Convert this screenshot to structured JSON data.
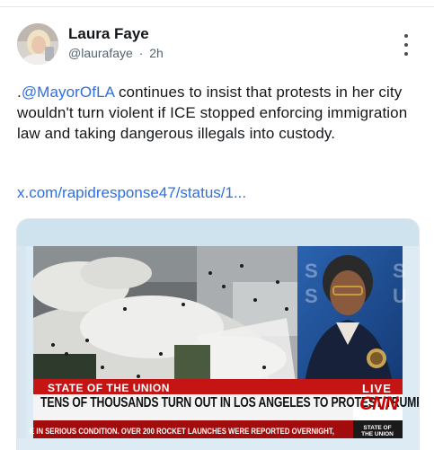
{
  "post": {
    "author_name": "Laura Faye",
    "handle": "@laurafaye",
    "separator": "·",
    "time": "2h",
    "text_prefix": ".",
    "mention": "@MayorOfLA",
    "text_body": " continues to insist that protests in her city wouldn't turn violent if ICE stopped enforcing immigration law and taking dangerous illegals into custody.",
    "link": "x.com/rapidresponse47/status/1..."
  },
  "media": {
    "program_label": "STATE OF THE UNION",
    "live_label": "LIVE",
    "headline": "TENS OF THOUSANDS TURN OUT IN LOS ANGELES TO PROTEST TRUMP",
    "ticker": "E IN SERIOUS CONDITION. OVER 200 ROCKET LAUNCHES WERE REPORTED OVERNIGHT,",
    "badge_line1": "STATE OF",
    "badge_line2": "THE UNION",
    "network_logo": "CNN"
  },
  "colors": {
    "link_blue": "#2f6fe0",
    "cnn_red": "#cc0000",
    "text": "#14171a",
    "muted": "#536471"
  },
  "icons": {
    "more": "more-vertical-icon"
  }
}
